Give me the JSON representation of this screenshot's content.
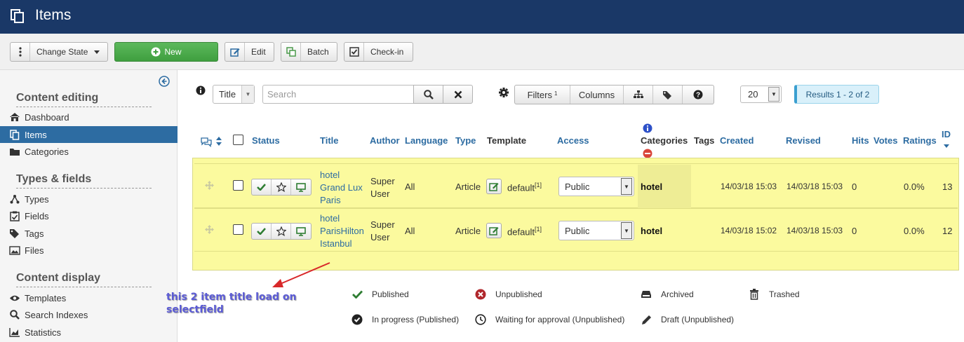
{
  "header": {
    "title": "Items"
  },
  "toolbar": {
    "change_state": "Change State",
    "new": "New",
    "edit": "Edit",
    "batch": "Batch",
    "checkin": "Check-in"
  },
  "sidebar": {
    "sections": [
      {
        "heading": "Content editing",
        "items": [
          {
            "label": "Dashboard",
            "icon": "home-icon"
          },
          {
            "label": "Items",
            "icon": "copy-icon",
            "active": true
          },
          {
            "label": "Categories",
            "icon": "folder-icon"
          }
        ]
      },
      {
        "heading": "Types & fields",
        "items": [
          {
            "label": "Types",
            "icon": "tree-icon"
          },
          {
            "label": "Fields",
            "icon": "checklist-icon"
          },
          {
            "label": "Tags",
            "icon": "tags-icon"
          },
          {
            "label": "Files",
            "icon": "image-icon"
          }
        ]
      },
      {
        "heading": "Content display",
        "items": [
          {
            "label": "Templates",
            "icon": "eye-icon"
          },
          {
            "label": "Search Indexes",
            "icon": "search-icon"
          },
          {
            "label": "Statistics",
            "icon": "chart-icon"
          }
        ]
      }
    ]
  },
  "search": {
    "field": "Title",
    "placeholder": "Search",
    "filters": "Filters",
    "filters_count": "1",
    "columns": "Columns",
    "limit": "20",
    "results": "Results 1 - 2 of 2"
  },
  "table": {
    "headers": {
      "status": "Status",
      "title": "Title",
      "author": "Author",
      "language": "Language",
      "type": "Type",
      "template": "Template",
      "access": "Access",
      "categories": "Categories",
      "tags": "Tags",
      "created": "Created",
      "revised": "Revised",
      "hits": "Hits",
      "votes": "Votes",
      "ratings": "Ratings",
      "id": "ID"
    },
    "rows": [
      {
        "title": [
          "hotel",
          "Grand Lux",
          "Paris"
        ],
        "author": [
          "Super",
          "User"
        ],
        "language": "All",
        "type": "Article",
        "template": "default",
        "template_sup": "[1]",
        "access": "Public",
        "category": "hotel",
        "created": "14/03/18 15:03",
        "revised": "14/03/18 15:03",
        "hits": "0",
        "ratings": "0.0%",
        "id": "13"
      },
      {
        "title": [
          "hotel",
          "ParisHilton",
          "Istanbul"
        ],
        "author": [
          "Super",
          "User"
        ],
        "language": "All",
        "type": "Article",
        "template": "default",
        "template_sup": "[1]",
        "access": "Public",
        "category": "hotel",
        "created": "14/03/18 15:02",
        "revised": "14/03/18 15:03",
        "hits": "0",
        "ratings": "0.0%",
        "id": "12"
      }
    ]
  },
  "legend": {
    "published": "Published",
    "unpublished": "Unpublished",
    "archived": "Archived",
    "trashed": "Trashed",
    "in_progress": "In progress (Published)",
    "waiting": "Waiting for approval (Unpublished)",
    "draft": "Draft (Unpublished)"
  },
  "annotation": [
    "this 2 item title load on",
    "selectfield"
  ],
  "colors": {
    "header_bg": "#1a3867",
    "active_blue": "#2d6ca2",
    "new_green": "#4cae4c",
    "row_yellow": "#fbfa9e"
  }
}
